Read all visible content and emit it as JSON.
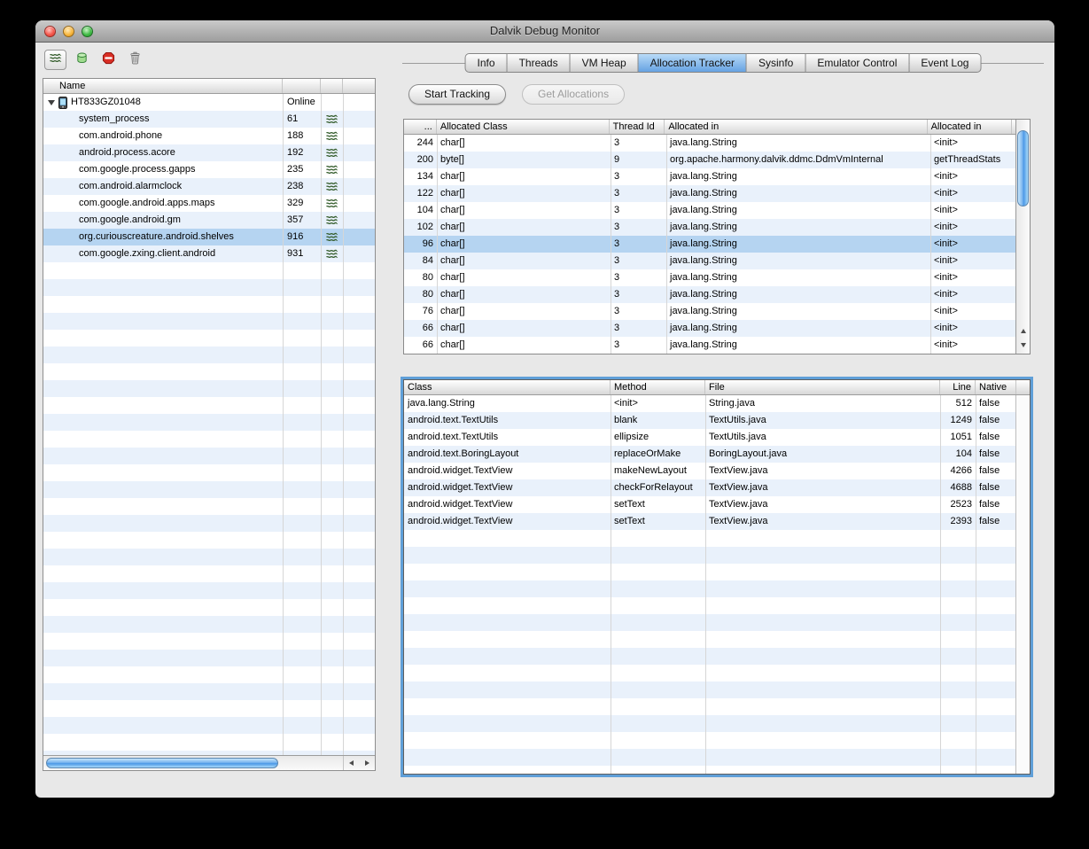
{
  "window": {
    "title": "Dalvik Debug Monitor"
  },
  "left_panel": {
    "toolbar": [
      {
        "label": "show-thread-updates",
        "icon": "threads-icon",
        "active": true
      },
      {
        "label": "update-heap",
        "icon": "heap-icon",
        "active": false
      },
      {
        "label": "stop-process",
        "icon": "stop-icon",
        "active": false
      },
      {
        "label": "garbage-collect",
        "icon": "trash-icon",
        "active": false
      }
    ],
    "name_header": "Name",
    "device": {
      "name": "HT833GZ01048",
      "status": "Online"
    },
    "processes": [
      {
        "name": "system_process",
        "pid": "61"
      },
      {
        "name": "com.android.phone",
        "pid": "188"
      },
      {
        "name": "android.process.acore",
        "pid": "192"
      },
      {
        "name": "com.google.process.gapps",
        "pid": "235"
      },
      {
        "name": "com.android.alarmclock",
        "pid": "238"
      },
      {
        "name": "com.google.android.apps.maps",
        "pid": "329"
      },
      {
        "name": "com.google.android.gm",
        "pid": "357"
      },
      {
        "name": "org.curiouscreature.android.shelves",
        "pid": "916",
        "selected": true
      },
      {
        "name": "com.google.zxing.client.android",
        "pid": "931"
      }
    ]
  },
  "tabs": [
    "Info",
    "Threads",
    "VM Heap",
    "Allocation Tracker",
    "Sysinfo",
    "Emulator Control",
    "Event Log"
  ],
  "selected_tab": "Allocation Tracker",
  "actions": {
    "start_tracking": "Start Tracking",
    "get_allocations": "Get Allocations",
    "get_allocations_enabled": false
  },
  "allocations": {
    "headers": [
      "...",
      "Allocated Class",
      "Thread Id",
      "Allocated in",
      "Allocated in"
    ],
    "selected_index": 6,
    "rows": [
      [
        "244",
        "char[]",
        "3",
        "java.lang.String",
        "<init>"
      ],
      [
        "200",
        "byte[]",
        "9",
        "org.apache.harmony.dalvik.ddmc.DdmVmInternal",
        "getThreadStats"
      ],
      [
        "134",
        "char[]",
        "3",
        "java.lang.String",
        "<init>"
      ],
      [
        "122",
        "char[]",
        "3",
        "java.lang.String",
        "<init>"
      ],
      [
        "104",
        "char[]",
        "3",
        "java.lang.String",
        "<init>"
      ],
      [
        "102",
        "char[]",
        "3",
        "java.lang.String",
        "<init>"
      ],
      [
        "96",
        "char[]",
        "3",
        "java.lang.String",
        "<init>"
      ],
      [
        "84",
        "char[]",
        "3",
        "java.lang.String",
        "<init>"
      ],
      [
        "80",
        "char[]",
        "3",
        "java.lang.String",
        "<init>"
      ],
      [
        "80",
        "char[]",
        "3",
        "java.lang.String",
        "<init>"
      ],
      [
        "76",
        "char[]",
        "3",
        "java.lang.String",
        "<init>"
      ],
      [
        "66",
        "char[]",
        "3",
        "java.lang.String",
        "<init>"
      ],
      [
        "66",
        "char[]",
        "3",
        "java.lang.String",
        "<init>"
      ]
    ]
  },
  "stack_trace": {
    "headers": [
      "Class",
      "Method",
      "File",
      "Line",
      "Native"
    ],
    "rows": [
      [
        "java.lang.String",
        "<init>",
        "String.java",
        "512",
        "false"
      ],
      [
        "android.text.TextUtils",
        "blank",
        "TextUtils.java",
        "1249",
        "false"
      ],
      [
        "android.text.TextUtils",
        "ellipsize",
        "TextUtils.java",
        "1051",
        "false"
      ],
      [
        "android.text.BoringLayout",
        "replaceOrMake",
        "BoringLayout.java",
        "104",
        "false"
      ],
      [
        "android.widget.TextView",
        "makeNewLayout",
        "TextView.java",
        "4266",
        "false"
      ],
      [
        "android.widget.TextView",
        "checkForRelayout",
        "TextView.java",
        "4688",
        "false"
      ],
      [
        "android.widget.TextView",
        "setText",
        "TextView.java",
        "2523",
        "false"
      ],
      [
        "android.widget.TextView",
        "setText",
        "TextView.java",
        "2393",
        "false"
      ]
    ]
  },
  "colors": {
    "stripe": "#e9f1fb",
    "selection": "#b5d4f1",
    "focus_ring": "#5f9fd8",
    "tab_selected_top": "#b9dbf8",
    "tab_selected_bottom": "#66a2e2",
    "scrollbar_thumb": "#4a97e6",
    "grid_line": "#d6d6d6",
    "window_background": "#e8e8e8"
  }
}
